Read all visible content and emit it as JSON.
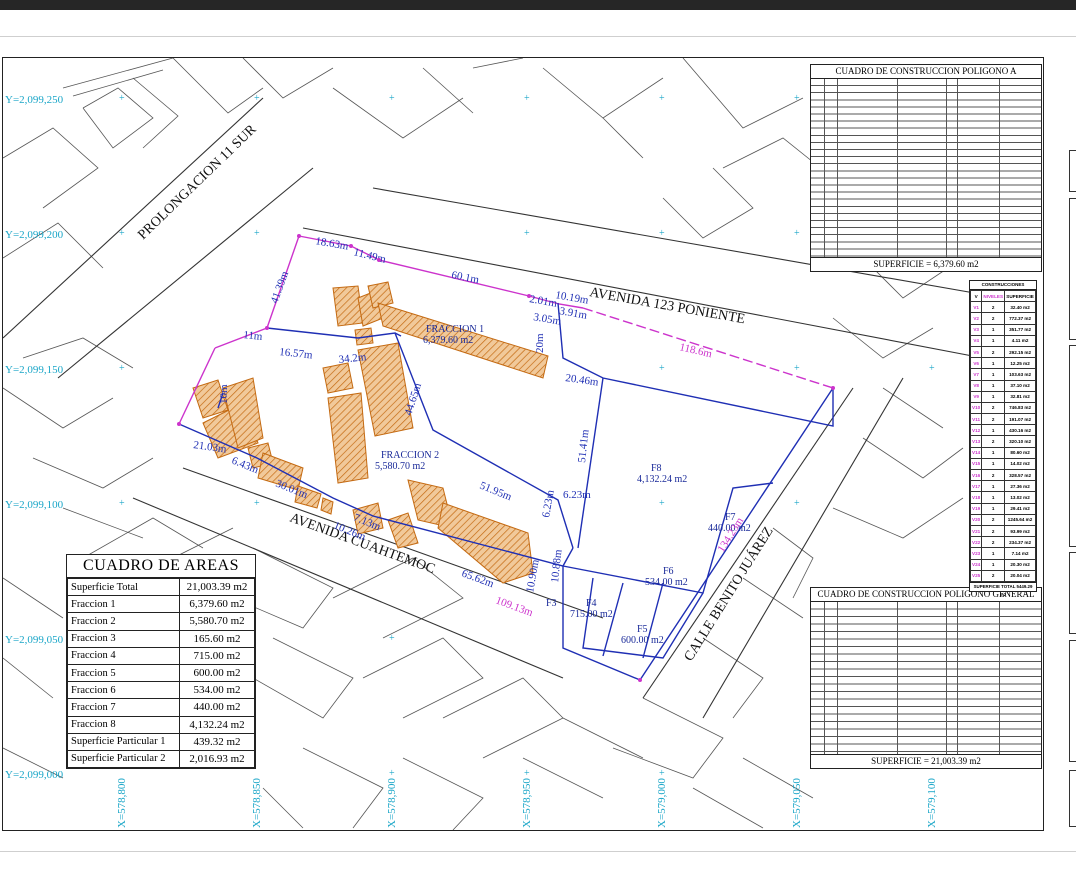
{
  "grid_labels": {
    "y": [
      "Y=2,099,250",
      "Y=2,099,200",
      "Y=2,099,150",
      "Y=2,099,100",
      "Y=2,099,050",
      "Y=2,099,000"
    ],
    "x": [
      "X=578,800",
      "X=578,850",
      "X=578,900",
      "X=578,950",
      "X=579,000",
      "X=579,050",
      "X=579,100"
    ]
  },
  "streets": {
    "prolongacion": "PROLONGACION 11 SUR",
    "avenida123": "AVENIDA 123 PONIENTE",
    "cuauhtemoc": "AVENIDA CUAHTEMOC",
    "benito": "CALLE BENITO JUÁREZ"
  },
  "fractions": {
    "f1": {
      "name": "FRACCION 1",
      "area": "6,379.60 m2"
    },
    "f2": {
      "name": "FRACCION 2",
      "area": "5,580.70 m2"
    },
    "f3": {
      "name": "F3"
    },
    "f4": {
      "name": "F4",
      "area": "715.00 m2"
    },
    "f5": {
      "name": "F5",
      "area": "600.00 m2"
    },
    "f6": {
      "name": "F6",
      "area": "534.00 m2"
    },
    "f7": {
      "name": "F7",
      "area": "440.00 m2"
    },
    "f8": {
      "name": "F8",
      "area": "4,132.24 m2"
    }
  },
  "dimensions": [
    "18.63m",
    "11.49m",
    "60.1m",
    "41.39m",
    "2.01m",
    "10.19m",
    "3.91m",
    "3.05m",
    "118.6m",
    "11m",
    "16.57m",
    "34.2m",
    "20m",
    "20.46m",
    "44.65m",
    "10m",
    "51.41m",
    "21.03m",
    "51.95m",
    "6.23m",
    "6.43m",
    "6.23m",
    "30.01m",
    "10.90m",
    "7.13m",
    "65.62m",
    "10.26m",
    "109.13m",
    "134.23m",
    "10.88m"
  ],
  "areas_table": {
    "title": "CUADRO DE AREAS",
    "rows": [
      {
        "label": "Superficie Total",
        "value": "21,003.39 m2"
      },
      {
        "label": "Fraccion 1",
        "value": "6,379.60 m2"
      },
      {
        "label": "Fraccion 2",
        "value": "5,580.70 m2"
      },
      {
        "label": "Fraccion 3",
        "value": "165.60 m2"
      },
      {
        "label": "Fraccion 4",
        "value": "715.00 m2"
      },
      {
        "label": "Fraccion 5",
        "value": "600.00 m2"
      },
      {
        "label": "Fraccion 6",
        "value": "534.00 m2"
      },
      {
        "label": "Fraccion 7",
        "value": "440.00 m2"
      },
      {
        "label": "Fraccion 8",
        "value": "4,132.24 m2"
      },
      {
        "label": "Superficie Particular 1",
        "value": "439.32  m2"
      },
      {
        "label": "Superficie Particular 2",
        "value": "2,016.93 m2"
      }
    ]
  },
  "ct_segregar": {
    "title": "CUADRO DE CONSTRUCCION POLIGONO A SEGREGAR",
    "surface": "SUPERFICIE = 6,379.60 m2"
  },
  "ct_general": {
    "title": "CUADRO DE CONSTRUCCION POLIGONO GENERAL",
    "surface": "SUPERFICIE = 21,003.39 m2"
  },
  "constructions": {
    "title": "CONSTRUCCIONES",
    "headers": [
      "V",
      "NIVELES",
      "SUPERFICIE"
    ],
    "rows": [
      [
        "V1",
        "2",
        "32.40 m2"
      ],
      [
        "V2",
        "2",
        "772.37 m2"
      ],
      [
        "V3",
        "1",
        "351.77 m2"
      ],
      [
        "V4",
        "1",
        "4.11 m2"
      ],
      [
        "V5",
        "2",
        "292.15 m2"
      ],
      [
        "V6",
        "1",
        "12.25 m2"
      ],
      [
        "V7",
        "1",
        "103.63 m2"
      ],
      [
        "V8",
        "1",
        "37.10 m2"
      ],
      [
        "V9",
        "1",
        "32.81 m2"
      ],
      [
        "V10",
        "2",
        "746.83 m2"
      ],
      [
        "V11",
        "2",
        "191.07 m2"
      ],
      [
        "V12",
        "1",
        "430.16 m2"
      ],
      [
        "V13",
        "2",
        "320.10 m2"
      ],
      [
        "V14",
        "1",
        "80.60 m2"
      ],
      [
        "V15",
        "1",
        "14.02 m2"
      ],
      [
        "V16",
        "2",
        "328.57 m2"
      ],
      [
        "V17",
        "1",
        "27.36 m2"
      ],
      [
        "V18",
        "1",
        "13.02 m2"
      ],
      [
        "V19",
        "1",
        "29.41 m2"
      ],
      [
        "V20",
        "2",
        "1245.64 m2"
      ],
      [
        "V21",
        "2",
        "93.99 m2"
      ],
      [
        "V22",
        "2",
        "234.37 m2"
      ],
      [
        "V23",
        "1",
        "7.14 m2"
      ],
      [
        "V24",
        "1",
        "20.30 m2"
      ],
      [
        "V25",
        "2",
        "20.04 m2"
      ]
    ],
    "total": "SUPERFICIE TOTAL 5449.29 m2"
  },
  "colors": {
    "boundary": "#1f2fb4",
    "segregate": "#cc33cc",
    "hatch": "#c46a12",
    "fill": "#f1c99a",
    "grid_text": "#1aa6c8"
  }
}
